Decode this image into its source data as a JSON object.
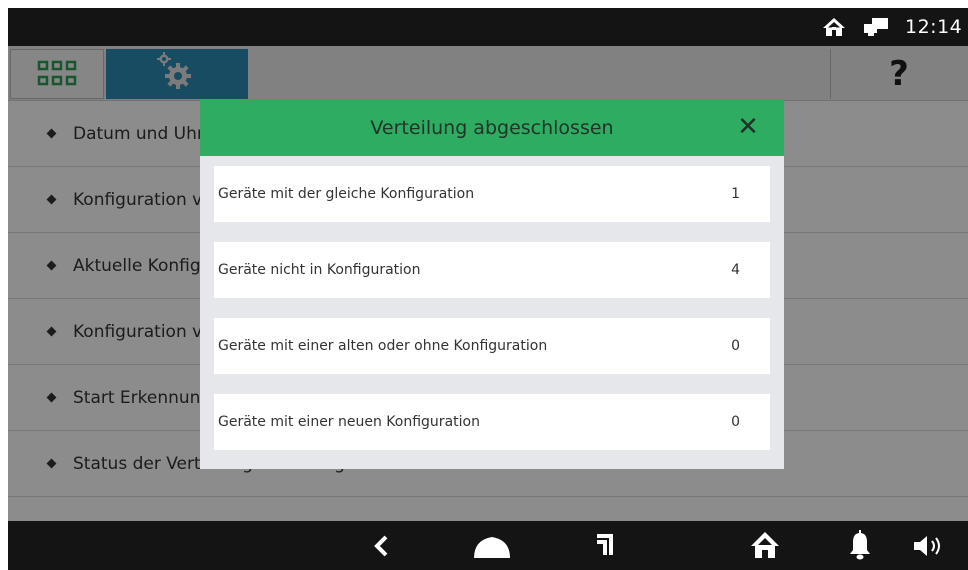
{
  "statusbar": {
    "time": "12:14",
    "icons": [
      "home-icon",
      "network-icon"
    ]
  },
  "toolbar": {
    "apps_icon": "grid-icon",
    "settings_icon": "gears-icon",
    "help_label": "?"
  },
  "settings_list": {
    "items": [
      {
        "label": "Datum und Uhrzeit"
      },
      {
        "label": "Konfiguration von"
      },
      {
        "label": "Aktuelle Konfiguration"
      },
      {
        "label": "Konfiguration von"
      },
      {
        "label": "Start Erkennung"
      },
      {
        "label": "Status der Verteilung der Konfiguration"
      }
    ]
  },
  "dialog": {
    "title": "Verteilung abgeschlossen",
    "close_label": "✕",
    "rows": [
      {
        "label": "Geräte mit der gleiche Konfiguration",
        "value": "1"
      },
      {
        "label": "Geräte nicht in Konfiguration",
        "value": "4"
      },
      {
        "label": "Geräte mit einer alten oder ohne Konfiguration",
        "value": "0"
      },
      {
        "label": "Geräte mit einer neuen Konfiguration",
        "value": "0"
      }
    ]
  },
  "navbar": {
    "icons": [
      "back-icon",
      "home-icon",
      "recent-apps-icon",
      "house-icon",
      "bell-icon",
      "volume-icon"
    ]
  },
  "colors": {
    "dialog_header": "#2ead62",
    "settings_tab": "#2b8ab2",
    "apps_icon": "#2b9d55",
    "bars": "#141414"
  }
}
